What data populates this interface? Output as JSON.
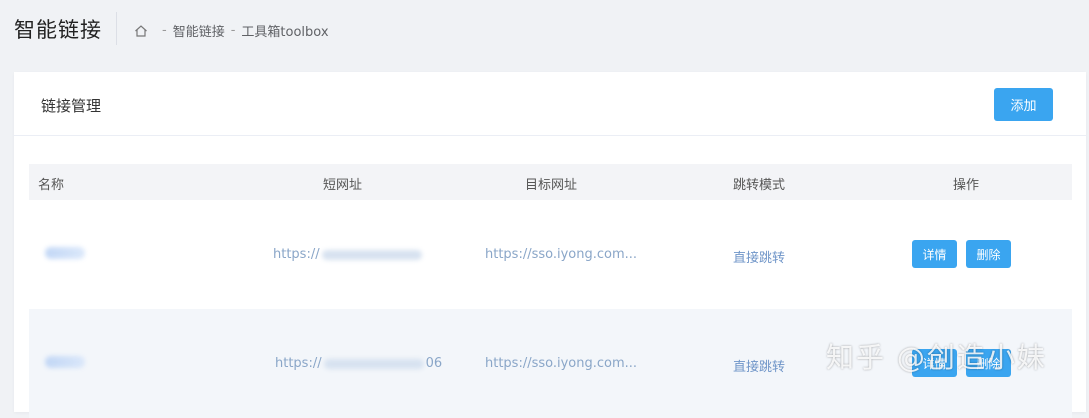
{
  "header": {
    "title": "智能链接",
    "breadcrumb": [
      {
        "label": "智能链接"
      },
      {
        "label": "工具箱toolbox"
      }
    ],
    "breadcrumb_separator": "-"
  },
  "card": {
    "title": "链接管理",
    "add_label": "添加"
  },
  "table": {
    "columns": [
      "名称",
      "短网址",
      "目标网址",
      "跳转模式",
      "操作"
    ],
    "rows": [
      {
        "name": "",
        "short_url_prefix": "https://",
        "short_url_suffix": "",
        "target_url": "https://sso.iyong.com...",
        "mode": "直接跳转",
        "actions": [
          "详情",
          "删除"
        ]
      },
      {
        "name": "",
        "short_url_prefix": "https://",
        "short_url_suffix": "06",
        "target_url": "https://sso.iyong.com...",
        "mode": "直接跳转",
        "actions": [
          "详情",
          "删除"
        ]
      }
    ]
  },
  "watermark": "知乎 @创造小妹",
  "colors": {
    "accent": "#3aa5f0",
    "link": "#8aa6c8",
    "page_bg": "#f0f2f5"
  }
}
